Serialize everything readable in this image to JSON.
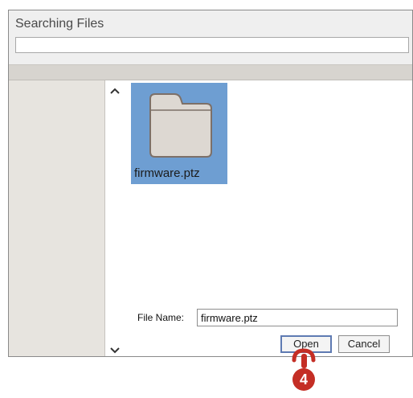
{
  "dialog": {
    "title": "Searching Files",
    "path_value": ""
  },
  "navigation": {
    "scroll_up_icon": "chevron-up-icon",
    "scroll_down_icon": "chevron-down-icon"
  },
  "files": [
    {
      "name": "firmware.ptz",
      "icon": "folder-icon",
      "selected": true
    }
  ],
  "footer": {
    "file_name_label": "File Name:",
    "file_name_value": "firmware.ptz",
    "open_label": "Open",
    "cancel_label": "Cancel"
  },
  "annotation": {
    "step_number": "4",
    "icon": "hand-pointer-icon",
    "color": "#c42e25"
  },
  "colors": {
    "selection": "#6e9ed2",
    "dialog_bg": "#efefef"
  }
}
